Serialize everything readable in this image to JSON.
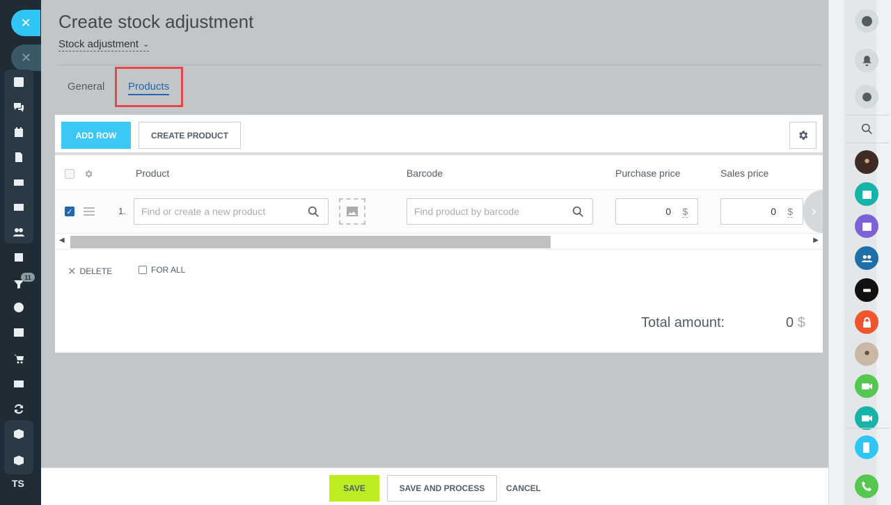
{
  "header": {
    "title": "Create stock adjustment",
    "document_type": "Stock adjustment"
  },
  "tabs": [
    {
      "label": "General",
      "active": false
    },
    {
      "label": "Products",
      "active": true
    }
  ],
  "toolbar": {
    "add_row_label": "ADD ROW",
    "create_product_label": "CREATE PRODUCT"
  },
  "table": {
    "columns": [
      "Product",
      "Barcode",
      "Purchase price",
      "Sales price"
    ],
    "rows": [
      {
        "number": "1.",
        "selected": true,
        "product_placeholder": "Find or create a new product",
        "barcode_placeholder": "Find product by barcode",
        "purchase_price": "0",
        "purchase_currency": "$",
        "sales_price": "0",
        "sales_currency": "$"
      }
    ]
  },
  "row_actions": {
    "delete_label": "DELETE",
    "for_all_label": "FOR ALL"
  },
  "totals": {
    "label": "Total amount:",
    "value": "0",
    "currency": "$"
  },
  "footer": {
    "save_label": "SAVE",
    "save_process_label": "SAVE AND PROCESS",
    "cancel_label": "CANCEL"
  },
  "left_sidebar": {
    "filter_badge": "11",
    "user_initials": "TS"
  },
  "colors": {
    "accent": "#3bc8f5",
    "save": "#bbed21",
    "active_tab": "#2066b0",
    "highlight": "#e8434b"
  }
}
